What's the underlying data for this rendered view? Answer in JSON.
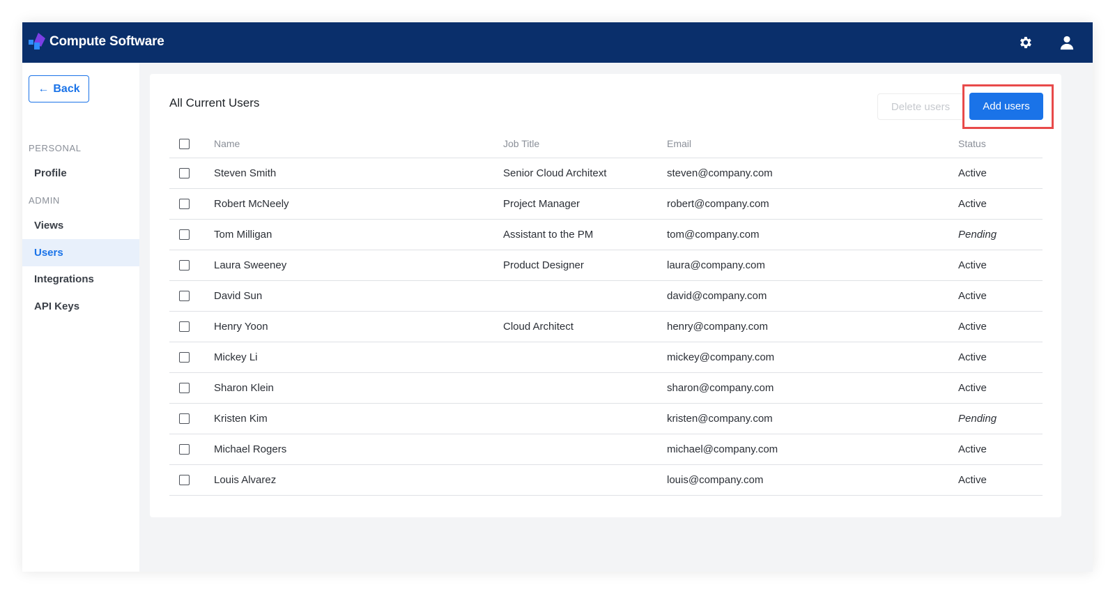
{
  "app": {
    "brand": "Compute Software"
  },
  "sidebar": {
    "back_label": "Back",
    "personal_label": "PERSONAL",
    "admin_label": "ADMIN",
    "items": [
      {
        "label": "Profile"
      },
      {
        "label": "Views"
      },
      {
        "label": "Users"
      },
      {
        "label": "Integrations"
      },
      {
        "label": "API Keys"
      }
    ]
  },
  "main": {
    "title": "All Current Users",
    "delete_label": "Delete users",
    "add_label": "Add users",
    "columns": {
      "name": "Name",
      "job": "Job Title",
      "email": "Email",
      "status": "Status"
    },
    "rows": [
      {
        "name": "Steven Smith",
        "job": "Senior Cloud Architext",
        "email": "steven@company.com",
        "status": "Active"
      },
      {
        "name": "Robert McNeely",
        "job": "Project Manager",
        "email": "robert@company.com",
        "status": "Active"
      },
      {
        "name": "Tom Milligan",
        "job": "Assistant to the PM",
        "email": "tom@company.com",
        "status": "Pending"
      },
      {
        "name": "Laura Sweeney",
        "job": "Product Designer",
        "email": "laura@company.com",
        "status": "Active"
      },
      {
        "name": "David Sun",
        "job": "",
        "email": "david@company.com",
        "status": "Active"
      },
      {
        "name": "Henry Yoon",
        "job": "Cloud Architect",
        "email": "henry@company.com",
        "status": "Active"
      },
      {
        "name": "Mickey Li",
        "job": "",
        "email": "mickey@company.com",
        "status": "Active"
      },
      {
        "name": "Sharon Klein",
        "job": "",
        "email": "sharon@company.com",
        "status": "Active"
      },
      {
        "name": "Kristen Kim",
        "job": "",
        "email": "kristen@company.com",
        "status": "Pending"
      },
      {
        "name": "Michael Rogers",
        "job": "",
        "email": "michael@company.com",
        "status": "Active"
      },
      {
        "name": "Louis Alvarez",
        "job": "",
        "email": "louis@company.com",
        "status": "Active"
      }
    ]
  },
  "icons": {
    "settings": "gear-icon",
    "account": "user-icon",
    "back": "arrow-left-icon"
  },
  "colors": {
    "header": "#0a2f6b",
    "accent": "#1a73e8",
    "highlight": "#e84a4a"
  }
}
